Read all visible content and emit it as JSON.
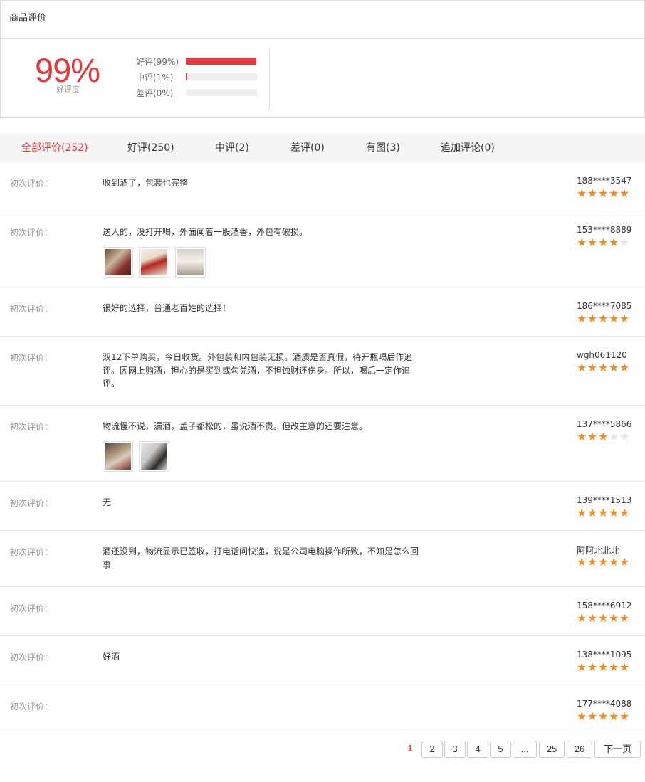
{
  "header": {
    "title": "商品评价"
  },
  "rating": {
    "percent": "99%",
    "label": "好评度",
    "bars": [
      {
        "label": "好评(99%)",
        "value": 0.99
      },
      {
        "label": "中评(1%)",
        "value": 0.01
      },
      {
        "label": "差评(0%)",
        "value": 0.0
      }
    ]
  },
  "tabs": [
    {
      "label": "全部评价(252)",
      "active": true
    },
    {
      "label": "好评(250)"
    },
    {
      "label": "中评(2)"
    },
    {
      "label": "差评(0)"
    },
    {
      "label": "有图(3)"
    },
    {
      "label": "追加评论(0)"
    }
  ],
  "review_label": "初次评价：",
  "reviews": [
    {
      "content": "收到酒了，包装也完整",
      "user": "188****3547",
      "stars": 5,
      "images": []
    },
    {
      "content": "送人的，没打开喝，外面闻着一股酒香，外包有破损。",
      "user": "153****8889",
      "stars": 4,
      "images": [
        "photo-1",
        "photo-2",
        "photo-3"
      ]
    },
    {
      "content": "很好的选择，普通老百姓的选择！",
      "user": "186****7085",
      "stars": 5,
      "images": []
    },
    {
      "content": "双12下单购买，今日收货。外包装和内包装无损。酒质是否真假，待开瓶喝后作追评。因网上购酒，担心的是买到或勾兑酒，不担蚀财还伤身。所以，喝后一定作追评。",
      "user": "wgh061120",
      "stars": 5,
      "images": []
    },
    {
      "content": "物流慢不说，漏酒，盖子都松的，虽说酒不贵。但改主意的还要注意。",
      "user": "137****5866",
      "stars": 3,
      "images": [
        "photo-4",
        "photo-5"
      ]
    },
    {
      "content": "无",
      "user": "139****1513",
      "stars": 5,
      "images": []
    },
    {
      "content": "酒还没到，物流显示已签收，打电话问快递，说是公司电脑操作所致，不知是怎么回事",
      "user": "阿阿北北北",
      "stars": 5,
      "images": []
    },
    {
      "content": "",
      "user": "158****6912",
      "stars": 5,
      "images": []
    },
    {
      "content": "好酒",
      "user": "138****1095",
      "stars": 5,
      "images": []
    },
    {
      "content": "",
      "user": "177****4088",
      "stars": 5,
      "images": []
    }
  ],
  "pagination": {
    "current": "1",
    "pages": [
      "2",
      "3",
      "4",
      "5",
      "...",
      "25",
      "26"
    ],
    "next": "下一页"
  },
  "colors": {
    "accent": "#e4393c",
    "star": "#f08d1e",
    "star_off": "#e6e6e6"
  },
  "icons": {
    "star": "star-icon"
  }
}
